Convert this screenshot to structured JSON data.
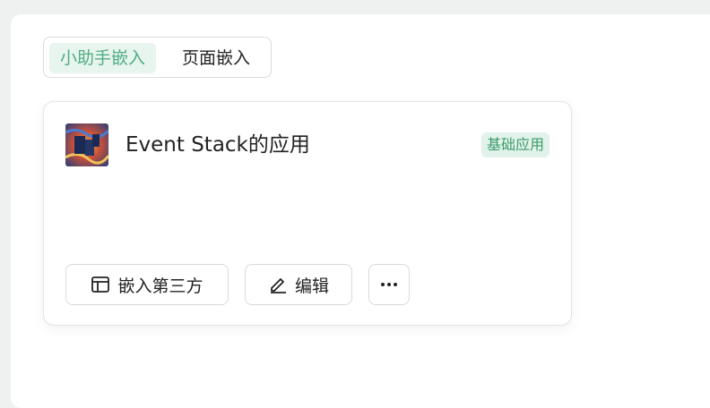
{
  "tabs": [
    {
      "label": "小助手嵌入",
      "active": true
    },
    {
      "label": "页面嵌入",
      "active": false
    }
  ],
  "app_card": {
    "title": "Event Stack的应用",
    "badge": "基础应用",
    "icon_name": "event-stack-app-icon",
    "buttons": {
      "embed_label": "嵌入第三方",
      "edit_label": "编辑",
      "more_icon": "more-dots-icon"
    }
  },
  "colors": {
    "accent_green": "#4fae84",
    "badge_bg": "#e0f2e9",
    "badge_text": "#3c9a6c",
    "background": "#eef1ef"
  }
}
